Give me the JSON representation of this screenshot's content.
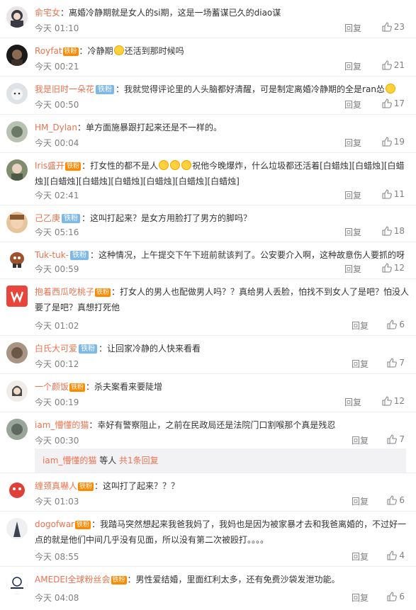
{
  "comments": [
    {
      "user": "俞宅女",
      "badges": [],
      "text": "离婚冷静期就是女人的si期，这是一场蓄谋已久的diao谋",
      "time": "今天 01:10",
      "reply": "回复",
      "likes": "23",
      "avatar_color": "#3a3a44"
    },
    {
      "user": "Royfat",
      "badges": [
        "vip"
      ],
      "vip_label": "铁粉",
      "text": "冷静期",
      "text2": "还活到那时候吗",
      "emojis": 1,
      "time": "今天 00:21",
      "reply": "回复",
      "likes": "21",
      "avatar_color": "#2a2320"
    },
    {
      "user": "我是旧时一朵花",
      "badges": [
        "fan"
      ],
      "fan_label": "铁粉",
      "text": "我就觉得评论里的人头脑都好清醒，可是制定离婚冷静期的全是ran怂",
      "time": "今天 00:50",
      "reply": "回复",
      "likes": "17",
      "avatar_color": "#d9dde3"
    },
    {
      "user": "HM_Dylan",
      "badges": [],
      "text": "单方面施暴跟打起来还是不一样的。",
      "time": "今天 00:04",
      "reply": "回复",
      "likes": "19",
      "avatar_color": "#8c9a8a"
    },
    {
      "user": "Iris盛开",
      "badges": [
        "vip"
      ],
      "vip_label": "铁粉",
      "text": "打女性的都不是人",
      "text2": "祝他今晚爆炸，什么垃圾都还活着[白蜡烛][白蜡烛][白蜡烛][白蜡烛][白蜡烛][白蜡烛][白蜡烛][白蜡烛][白蜡烛]",
      "emojis": 3,
      "time": "今天 02:41",
      "reply": "回复",
      "likes": "11",
      "avatar_color": "#4d5a46"
    },
    {
      "user": "己乙庚",
      "badges": [
        "fan"
      ],
      "fan_label": "铁粉",
      "text": "这叫打起来？是女方用脸打了男方的脚吗？",
      "time": "今天 05:16",
      "reply": "回复",
      "likes": "18",
      "avatar_color": "#c98a5a"
    },
    {
      "user": "Tuk-tuk-",
      "badges": [
        "fan"
      ],
      "fan_label": "铁粉",
      "text": "这种情况，上午提交下午下班前就该判了。公安要介入啊，这种故意伤人要抓的呀",
      "time": "今天 00:59",
      "reply": "回复",
      "likes": "12",
      "avatar_color": "#a0522d"
    },
    {
      "user": "抱着西瓜吃桃子",
      "badges": [
        "vip"
      ],
      "vip_label": "铁粉",
      "text": "打女人的男人也配做男人吗？？真给男人丢脸，怕找不到女人了是吧？怕没人要了是吧？真想打死他",
      "time": "今天 01:02",
      "reply": "回复",
      "likes": "6",
      "avatar_color": "#e8453c"
    },
    {
      "user": "白氏大可爱",
      "badges": [
        "fan"
      ],
      "fan_label": "铁粉",
      "text": "让回家冷静的人快来看看",
      "time": "今天 00:12",
      "reply": "回复",
      "likes": "7",
      "avatar_color": "#7a6a5a"
    },
    {
      "user": "一个颜饭",
      "badges": [
        "vip"
      ],
      "vip_label": "铁粉",
      "text": "杀夫案看来要陡增",
      "time": "今天 00:19",
      "reply": "回复",
      "likes": "12",
      "avatar_color": "#2b2b2b"
    },
    {
      "user": "iam_懵懂的猫",
      "badges": [],
      "text": "幸好有警察阻止，之前在民政局还是法院门口割喉那个真是残忍",
      "time": "今天 00:30",
      "reply": "回复",
      "likes": "7",
      "avatar_color": "#6f7b70"
    },
    {
      "user": "缠颈真嚇人",
      "badges": [
        "vip"
      ],
      "vip_label": "铁粉",
      "text": "这叫打了起来？？？",
      "time": "今天 01:03",
      "reply": "回复",
      "likes": "6",
      "avatar_color": "#e0403a"
    },
    {
      "user": "dogofwar",
      "badges": [
        "vip"
      ],
      "vip_label": "铁粉",
      "text": "我踏马突然想起来我爸我妈了，我妈也是因为被家暴才去和我爸离婚的，不过好一点的就是他们中间几乎没有见面，所以没有第二次被殴打。。。。",
      "time": "今天 08:55",
      "reply": "回复",
      "likes": "4",
      "avatar_color": "#5a6470"
    },
    {
      "user": "AMEDEI全球粉丝会",
      "badges": [
        "vip"
      ],
      "vip_label": "铁粉",
      "text": "男性爱结婚，里面红利太多，还有免费沙袋发泄功能。",
      "time": "今天 04:08",
      "reply": "回复",
      "likes": "6",
      "avatar_color": "#ffffff"
    }
  ],
  "thread": {
    "user": "iam_懵懂的猫",
    "middle": " 等人 ",
    "total": "共1条回复"
  },
  "colors": {
    "username": "#eb7350",
    "meta": "#808080",
    "badge": "#7db8ea"
  }
}
